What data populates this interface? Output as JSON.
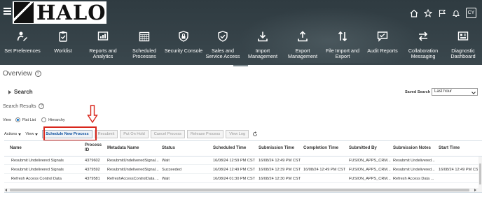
{
  "header": {
    "logo_text": "HALO",
    "user_initials": "CY",
    "nav": [
      {
        "label": "Set Preferences",
        "icon": "person-edit-icon"
      },
      {
        "label": "Worklist",
        "icon": "clipboard-check-icon"
      },
      {
        "label": "Reports and Analytics",
        "icon": "report-chart-icon"
      },
      {
        "label": "Scheduled Processes",
        "icon": "calendar-grid-icon"
      },
      {
        "label": "Security Console",
        "icon": "shield-lock-icon"
      },
      {
        "label": "Sales and Service Access",
        "icon": "shield-check-icon"
      },
      {
        "label": "Import Management",
        "icon": "download-icon"
      },
      {
        "label": "Export Management",
        "icon": "upload-icon"
      },
      {
        "label": "File Import and Export",
        "icon": "up-down-arrows-icon"
      },
      {
        "label": "Audit Reports",
        "icon": "audit-chat-icon"
      },
      {
        "label": "Collaboration Messaging",
        "icon": "exchange-arrows-icon"
      },
      {
        "label": "Diagnostic Dashboard",
        "icon": "dashboard-icon"
      }
    ]
  },
  "page": {
    "title": "Overview",
    "search_label": "Search",
    "saved_search_label": "Saved Search",
    "saved_search_value": "Last hour",
    "results_label": "Search Results",
    "view_label": "View",
    "view_options": [
      "Flat List",
      "Hierarchy"
    ],
    "selected_view": "Flat List"
  },
  "toolbar": {
    "actions_label": "Actions",
    "view_label": "View",
    "buttons": [
      "Schedule New Process",
      "Resubmit",
      "Put On Hold",
      "Cancel Process",
      "Release Process",
      "View Log"
    ]
  },
  "table": {
    "columns": [
      "Name",
      "Process ID",
      "Metadata Name",
      "Status",
      "Scheduled Time",
      "Submission Time",
      "Completion Time",
      "Submitted By",
      "Submission Notes",
      "Start Time"
    ],
    "rows": [
      [
        "Resubmit Undelivered Signals",
        "4379602",
        "ResubmitUndeliveredSignal...",
        "Wait",
        "16/08/24 12:59 PM CST",
        "16/08/24 12:49 PM CST",
        "",
        "FUSION_APPS_CRM...",
        "Resubmit Undelivered...",
        ""
      ],
      [
        "Resubmit Undelivered Signals",
        "4379592",
        "ResubmitUndeliveredSignal...",
        "Succeeded",
        "16/08/24 12:49 PM CST",
        "16/08/24 12:39 PM CST",
        "16/08/24 12:49 PM CST",
        "FUSION_APPS_CRM...",
        "Resubmit Undelivered...",
        "16/08/24 12:49 PM CS"
      ],
      [
        "Refresh Access Control Data",
        "4379581",
        "RefreshAccessControlData ...",
        "Wait",
        "16/08/24 01:30 PM CST",
        "16/08/24 12:30 PM CST",
        "",
        "FUSION_APPS_CRM...",
        "Refresh Access Data ...",
        ""
      ]
    ]
  },
  "colors": {
    "banner": "#3a474d",
    "highlight": "#d8261c",
    "accent": "#0572ce"
  }
}
